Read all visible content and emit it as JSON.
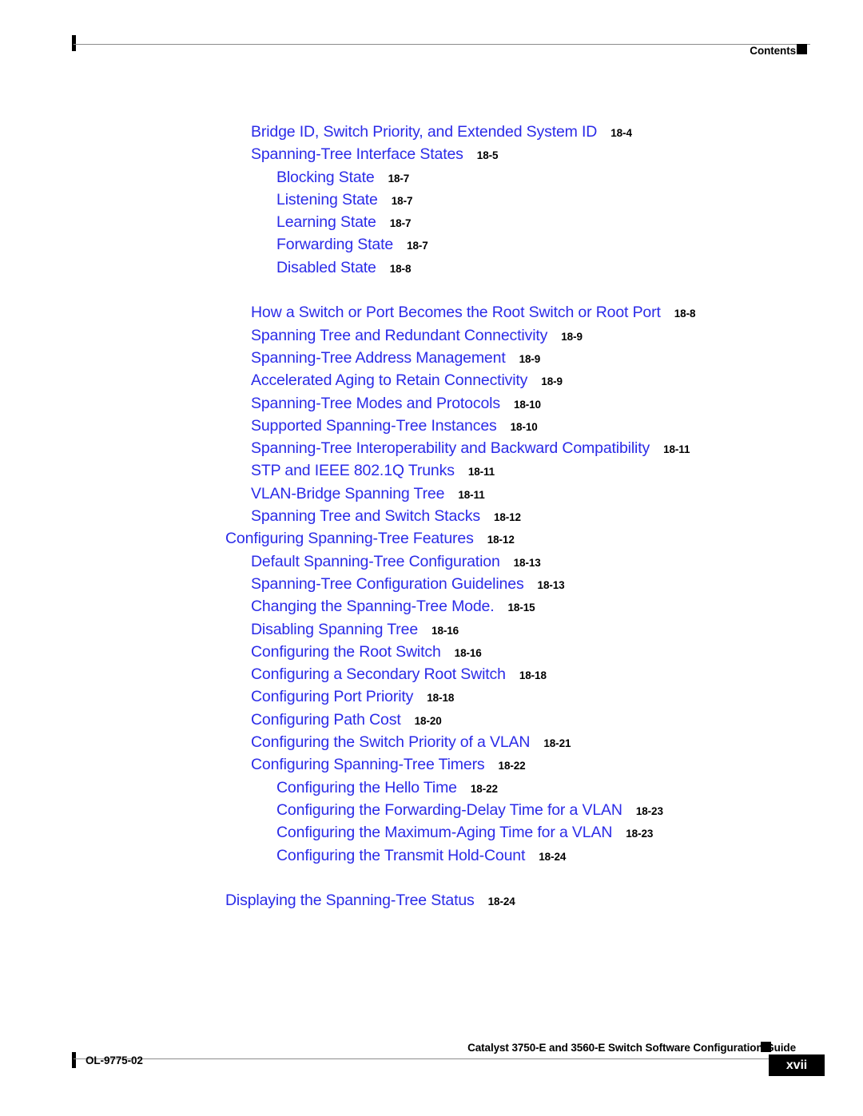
{
  "header": {
    "label": "Contents",
    "square_icon": "black-square-icon"
  },
  "footer": {
    "doc_id": "OL-9775-02",
    "guide_title": "Catalyst 3750-E and 3560-E Switch Software Configuration Guide",
    "page_number": "xvii",
    "square_icon": "black-square-icon"
  },
  "colors": {
    "link_blue": "#2B2BE8",
    "text_black": "#000000",
    "rule_gray": "#8C8C8C",
    "page_background": "#FFFFFF"
  },
  "toc": {
    "entries": [
      {
        "level": 2,
        "title": "Bridge ID, Switch Priority, and Extended System ID",
        "page": "18-4"
      },
      {
        "level": 2,
        "title": "Spanning-Tree Interface States",
        "page": "18-5"
      },
      {
        "level": 3,
        "title": "Blocking State",
        "page": "18-7"
      },
      {
        "level": 3,
        "title": "Listening State",
        "page": "18-7"
      },
      {
        "level": 3,
        "title": "Learning State",
        "page": "18-7"
      },
      {
        "level": 3,
        "title": "Forwarding State",
        "page": "18-7"
      },
      {
        "level": 3,
        "title": "Disabled State",
        "page": "18-8"
      },
      {
        "level": 2,
        "title": "How a Switch or Port Becomes the Root Switch or Root Port",
        "page": "18-8"
      },
      {
        "level": 2,
        "title": "Spanning Tree and Redundant Connectivity",
        "page": "18-9"
      },
      {
        "level": 2,
        "title": "Spanning-Tree Address Management",
        "page": "18-9"
      },
      {
        "level": 2,
        "title": "Accelerated Aging to Retain Connectivity",
        "page": "18-9"
      },
      {
        "level": 2,
        "title": "Spanning-Tree Modes and Protocols",
        "page": "18-10"
      },
      {
        "level": 2,
        "title": "Supported Spanning-Tree Instances",
        "page": "18-10"
      },
      {
        "level": 2,
        "title": "Spanning-Tree Interoperability and Backward Compatibility",
        "page": "18-11"
      },
      {
        "level": 2,
        "title": "STP and IEEE 802.1Q Trunks",
        "page": "18-11"
      },
      {
        "level": 2,
        "title": "VLAN-Bridge Spanning Tree",
        "page": "18-11"
      },
      {
        "level": 2,
        "title": "Spanning Tree and Switch Stacks",
        "page": "18-12"
      },
      {
        "level": 1,
        "title": "Configuring Spanning-Tree Features",
        "page": "18-12"
      },
      {
        "level": 2,
        "title": "Default Spanning-Tree Configuration",
        "page": "18-13"
      },
      {
        "level": 2,
        "title": "Spanning-Tree Configuration Guidelines",
        "page": "18-13"
      },
      {
        "level": 2,
        "title": "Changing the Spanning-Tree Mode.",
        "page": "18-15"
      },
      {
        "level": 2,
        "title": "Disabling Spanning Tree",
        "page": "18-16"
      },
      {
        "level": 2,
        "title": "Configuring the Root Switch",
        "page": "18-16"
      },
      {
        "level": 2,
        "title": "Configuring a Secondary Root Switch",
        "page": "18-18"
      },
      {
        "level": 2,
        "title": "Configuring Port Priority",
        "page": "18-18"
      },
      {
        "level": 2,
        "title": "Configuring Path Cost",
        "page": "18-20"
      },
      {
        "level": 2,
        "title": "Configuring the Switch Priority of a VLAN",
        "page": "18-21"
      },
      {
        "level": 2,
        "title": "Configuring Spanning-Tree Timers",
        "page": "18-22"
      },
      {
        "level": 3,
        "title": "Configuring the Hello Time",
        "page": "18-22"
      },
      {
        "level": 3,
        "title": "Configuring the Forwarding-Delay Time for a VLAN",
        "page": "18-23"
      },
      {
        "level": 3,
        "title": "Configuring the Maximum-Aging Time for a VLAN",
        "page": "18-23"
      },
      {
        "level": 3,
        "title": "Configuring the Transmit Hold-Count",
        "page": "18-24"
      },
      {
        "level": 1,
        "title": "Displaying the Spanning-Tree Status",
        "page": "18-24"
      }
    ]
  }
}
